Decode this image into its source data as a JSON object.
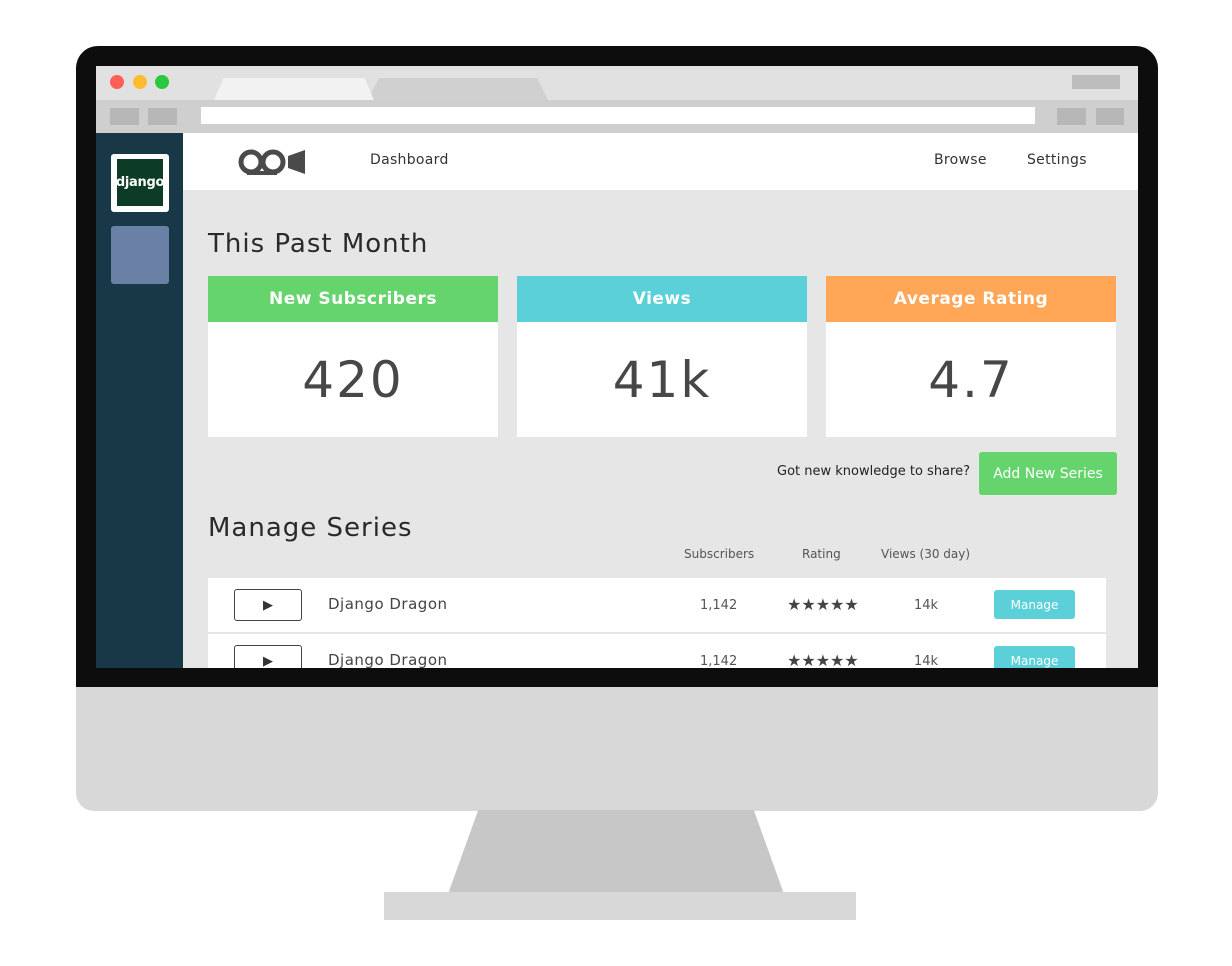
{
  "browser": {
    "traffic_colors": [
      "#ff5f57",
      "#febc2e",
      "#28c840"
    ]
  },
  "sidebar": {
    "app_label": "django"
  },
  "nav": {
    "logo_icon": "video-camera-logo-icon",
    "dashboard": "Dashboard",
    "browse": "Browse",
    "settings": "Settings"
  },
  "stats": {
    "title": "This Past Month",
    "cards": [
      {
        "label": "New Subscribers",
        "value": "420",
        "color": "#66d46c"
      },
      {
        "label": "Views",
        "value": "41k",
        "color": "#5bd0d9"
      },
      {
        "label": "Average Rating",
        "value": "4.7",
        "color": "#ffa657"
      }
    ]
  },
  "cta": {
    "prompt": "Got new knowledge to share?",
    "button": "Add New Series"
  },
  "series": {
    "title": "Manage Series",
    "columns": {
      "subscribers": "Subscribers",
      "rating": "Rating",
      "views": "Views (30 day)"
    },
    "rows": [
      {
        "play": "▶",
        "name": "Django Dragon",
        "subscribers": "1,142",
        "stars": "★★★★★",
        "views": "14k",
        "action": "Manage"
      },
      {
        "play": "▶",
        "name": "Django Dragon",
        "subscribers": "1,142",
        "stars": "★★★★★",
        "views": "14k",
        "action": "Manage"
      }
    ]
  }
}
